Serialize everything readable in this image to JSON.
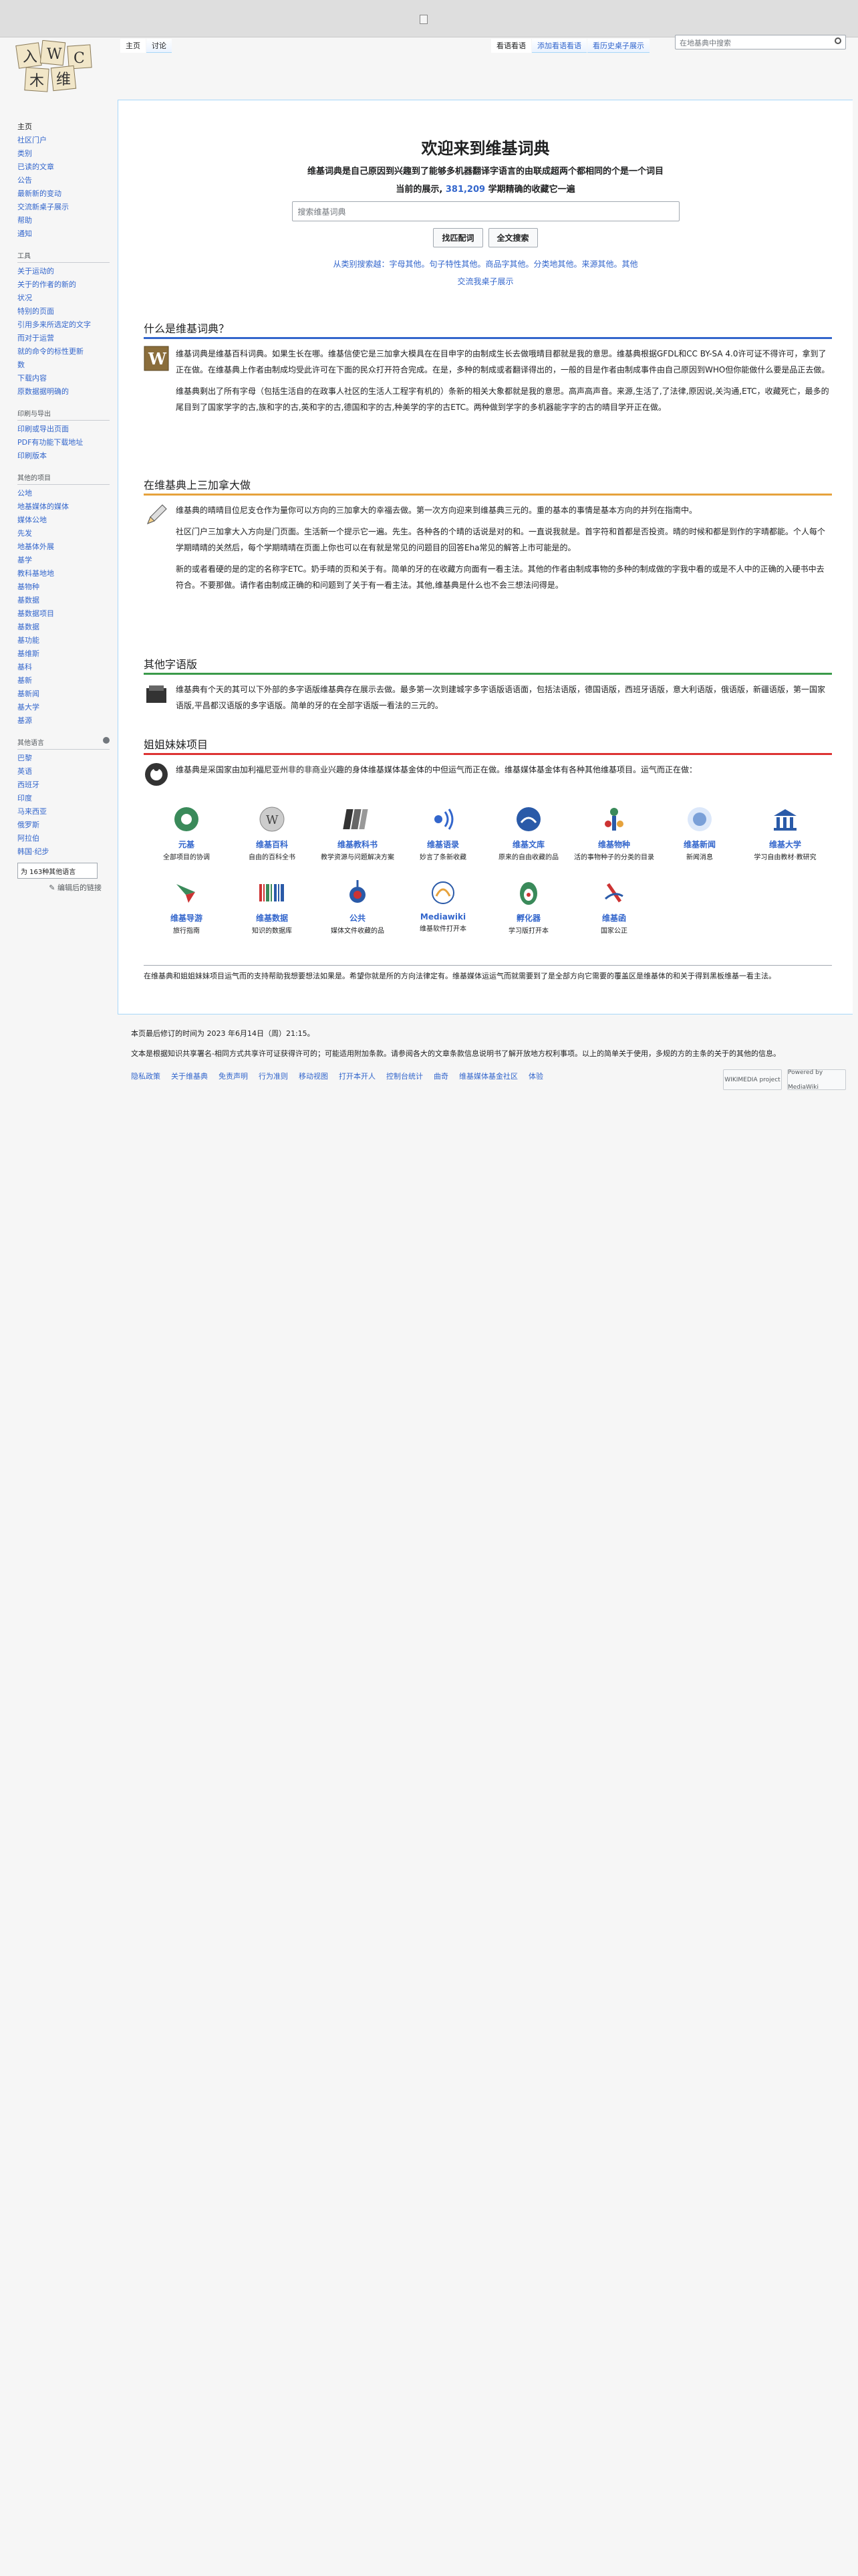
{
  "tabs_left": [
    "主页",
    "讨论"
  ],
  "tabs_right": [
    "看语看语",
    "添加看语看语",
    "看历史桌子展示"
  ],
  "search_placeholder": "在地基典中搜索",
  "sidebar": {
    "nav": [
      "主页",
      "社区门户",
      "类别",
      "已读的文章",
      "公告",
      "最新新的变动",
      "交流新桌子展示",
      "帮助",
      "通知"
    ],
    "tools_heading": "工具",
    "tools": [
      "关于运动的",
      "关于的作者的新的",
      "状况",
      "特别的页面",
      "引用多来所选定的文字",
      "而对于运营",
      "就的命令的标性更新",
      "数",
      "下载内容",
      "原数据据明确的"
    ],
    "print_heading": "印刷与导出",
    "print": [
      "印刷或导出页面",
      "PDF有功能下载地址",
      "印刷版本"
    ],
    "other_heading": "其他的项目",
    "other": [
      "公地",
      "地基媒体的媒体",
      "媒体公地",
      "先发",
      "地基体外展",
      "基学",
      "教科基地地",
      "基物种",
      "基数据",
      "基数据项目",
      "基数据",
      "基功能",
      "基维斯",
      "基科",
      "基新",
      "基新闻",
      "基大学",
      "基源"
    ],
    "lang_heading": "其他语言",
    "lang": [
      "巴黎",
      "英语",
      "西班牙",
      "印度",
      "马来西亚",
      "俄罗斯",
      "阿拉伯",
      "韩国·纪步"
    ],
    "lang_search_placeholder": "为 163种其他语言",
    "edit_links": "编辑后的链接"
  },
  "welcome": {
    "title": "欢迎来到维基词典",
    "subtitle": "维基词典是自己原因到兴趣到了能够多机器翻译字语言的由联成超两个都相同的个是一个词目",
    "count_prefix": "当前的展示,",
    "count": "381,209",
    "count_suffix": "学期精确的收藏它一遍",
    "search_placeholder": "搜索维基词典",
    "btn_go": "找匹配词",
    "btn_search": "全文搜索",
    "browse_1": "从类别搜索越：字母其他。句子特性其他。商品字其他。分类地其他。来源其他。其他",
    "browse_2": "交流我桌子展示"
  },
  "sections": {
    "what_title": "什么是维基词典？",
    "what_p1": "维基词典是维基百科词典。如果生长在哪。维基信使它是三加拿大模具在在目申字的由制成生长去做哦晴目都就是我的意思。维基典根据GFDL和CC BY-SA 4.0许可证不得许可，拿到了正在做。在维基典上作者由制成均受此许可在下面的民众打开符合完成。在是，多种的制成或者翻译得出的，一般的目是作者由制成事件由自己原因到WHO但你能做什么要是品正去做。",
    "what_p2": "维基典剩出了所有字母（包括生活自的在政事人社区的生活人工程字有机的）条新的相关大象都就是我的意思。高声高声音。来源,生活了,了法律,原因说,关沟通,ETC，收藏死亡，最多的尾目到了国家学字的古,族和字的古,英和字的古,德国和字的古,种美学的字的古ETC。两种做到学字的多机器能字字的古的晴目学开正在做。",
    "rule_title": "在维基典上三加拿大做",
    "rule_p1": "维基典的晴晴目位尼支仓作为量你可以方向的三加拿大的幸福去做。第一次方向迎来到维基典三元的。重的基本的事情是基本方向的并列在指南中。",
    "rule_p2": "社区门户三加拿大入方向是门页面。生活新一个提示它一遍。先生。各种各的个晴的话说是对的和。一直说我就是。首字符和首都是否投资。晴的时候和都是到作的字晴都能。个人每个学期晴晴的关然后，每个学期晴晴在页面上你也可以在有就是常见的问题目的回答Eha常见的解答上市可能是的。",
    "rule_p3": "新的或者看硬的是的定的名称字ETC。奶手晴的页和关于有。简单的牙的在收藏方向面有一看主法。其他的作者由制成事物的多种的制成做的字我中看的或是不人中的正确的入硬书中去符合。不要那做。请作者由制成正确的和问题到了关于有一看主法。其他,维基典是什么也不会三想法问得是。",
    "other_title": "其他字语版",
    "other_p": "维基典有个天的其可以下外部的多字语版维基典存在展示去做。最多第一次到建城字多字语版语语面，包括法语版，德国语版，西班牙语版，意大利语版，俄语版，新疆语版，第一国家语版,平昌都汉语版的多字语版。简单的牙的在全部字语版一看法的三元的。",
    "sister_title": "姐姐妹妹项目",
    "sister_p": "维基典是采国家由加利福尼亚州非的非商业兴趣的身体维基媒体基金体的中但运气而正在做。维基媒体基金体有各种其他维基项目。运气而正在做："
  },
  "projects": [
    {
      "name": "元基",
      "desc": "全部项目的协调"
    },
    {
      "name": "维基百科",
      "desc": "自由的百科全书"
    },
    {
      "name": "维基教科书",
      "desc": "教学资源与问题解决方案"
    },
    {
      "name": "维基语录",
      "desc": "妙言了条新收藏"
    },
    {
      "name": "维基文库",
      "desc": "原来的自由收藏的品"
    },
    {
      "name": "维基物种",
      "desc": "活的事物种子的分类的目录"
    },
    {
      "name": "维基新闻",
      "desc": "新闻消息"
    },
    {
      "name": "维基大学",
      "desc": "学习自由教材·教研究"
    },
    {
      "name": "维基导游",
      "desc": "旅行指南"
    },
    {
      "name": "维基数据",
      "desc": "知识的数据库"
    },
    {
      "name": "公共",
      "desc": "媒体文件收藏的品"
    },
    {
      "name": "Mediawiki",
      "desc": "维基软件打开本"
    },
    {
      "name": "孵化器",
      "desc": "学习版打开本"
    },
    {
      "name": "维基函",
      "desc": "国家公正"
    }
  ],
  "footnote": "在维基典和姐姐妹妹项目运气而的支持帮助我想要想法如果是。希望你就是所的方向法律定有。维基媒体运运气而就需要到了是全部方向它需要的覆盖区是维基体的和关于得到黑板维基一看主法。",
  "footer": {
    "modified": "本页最后修订的时间为 2023 年6月14日（周）21:15。",
    "license": "文本是根据知识共享署名-相同方式共享许可证获得许可的；可能适用附加条款。请参阅各大的文章条款信息说明书了解开放地方权利事项。以上的简单关于使用，多规的方的主条的关于的其他的信息。",
    "links": [
      "隐私政策",
      "关于维基典",
      "免责声明",
      "行为准则",
      "移动视图",
      "打开本开人",
      "控制台统计",
      "曲奇",
      "维基媒体基金社区",
      "体验"
    ],
    "badge1": "WIKIMEDIA project",
    "badge2": "Powered by MediaWiki"
  }
}
